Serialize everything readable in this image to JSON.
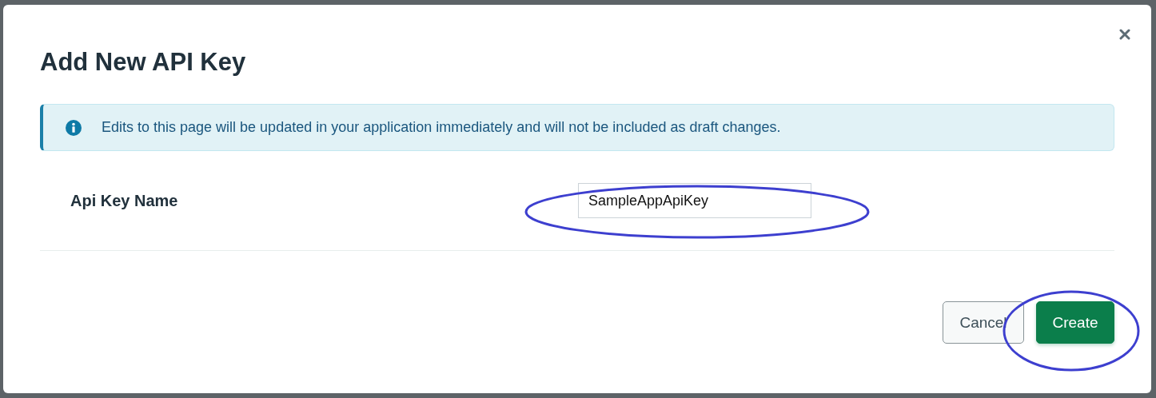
{
  "dialog": {
    "title": "Add New API Key"
  },
  "alert": {
    "text": "Edits to this page will be updated in your application immediately and will not be included as draft changes."
  },
  "field": {
    "label": "Api Key Name",
    "value": "SampleAppApiKey"
  },
  "buttons": [
    {
      "label": "Cancel",
      "kind": "secondary"
    },
    {
      "label": "Create",
      "kind": "primary"
    }
  ]
}
